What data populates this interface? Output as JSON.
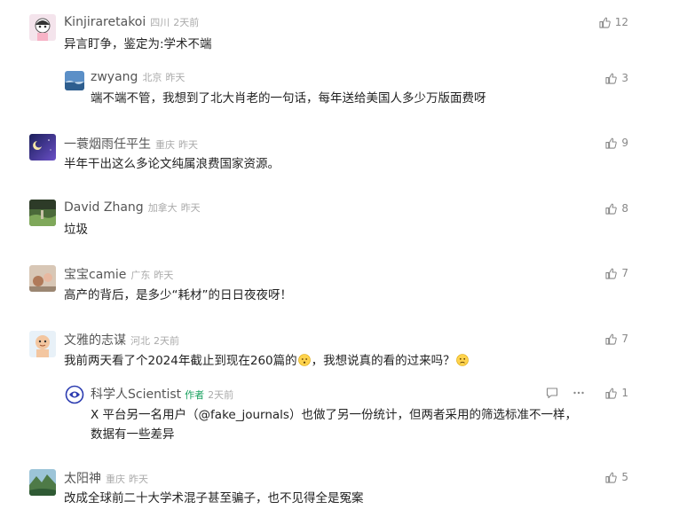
{
  "comments": [
    {
      "name": "Kinjiraretakoi",
      "location": "四川",
      "time": "2天前",
      "likes": "12",
      "text": "异言盯争，鉴定为:学术不端"
    },
    {
      "name": "zwyang",
      "location": "北京",
      "time": "昨天",
      "likes": "3",
      "text": "端不端不管，我想到了北大肖老的一句话，每年送给美国人多少万版面费呀"
    },
    {
      "name": "一蓑烟雨任平生",
      "location": "重庆",
      "time": "昨天",
      "likes": "9",
      "text": "半年干出这么多论文纯属浪费国家资源。"
    },
    {
      "name": "David Zhang",
      "location": "加拿大",
      "time": "昨天",
      "likes": "8",
      "text": "垃圾"
    },
    {
      "name": "宝宝camie",
      "location": "广东",
      "time": "昨天",
      "likes": "7",
      "text": "高产的背后，是多少“耗材”的日日夜夜呀！"
    },
    {
      "name": "文雅的志谋",
      "location": "河北",
      "time": "2天前",
      "likes": "7",
      "text_before": "我前两天看了个2024年截止到现在260篇的",
      "text_middle": "，我想说真的看的过来吗？",
      "text_after": ""
    },
    {
      "name": "科学人Scientist",
      "author_tag": "作者",
      "time": "2天前",
      "likes": "1",
      "text_line1": "X 平台另一名用户（@fake_journals）也做了另一份统计，但两者采用的筛选标准不一样，",
      "text_line2": "数据有一些差异"
    },
    {
      "name": "太阳神",
      "location": "重庆",
      "time": "昨天",
      "likes": "5",
      "text": "改成全球前二十大学术混子甚至骗子，也不见得全是冤案"
    }
  ],
  "icons": {
    "like": "thumbs-up-icon",
    "reply": "comment-icon",
    "more": "more-dots-icon"
  },
  "colors": {
    "author_tag": "#19a15f",
    "meta": "#aaaaaa",
    "name": "#555555"
  }
}
